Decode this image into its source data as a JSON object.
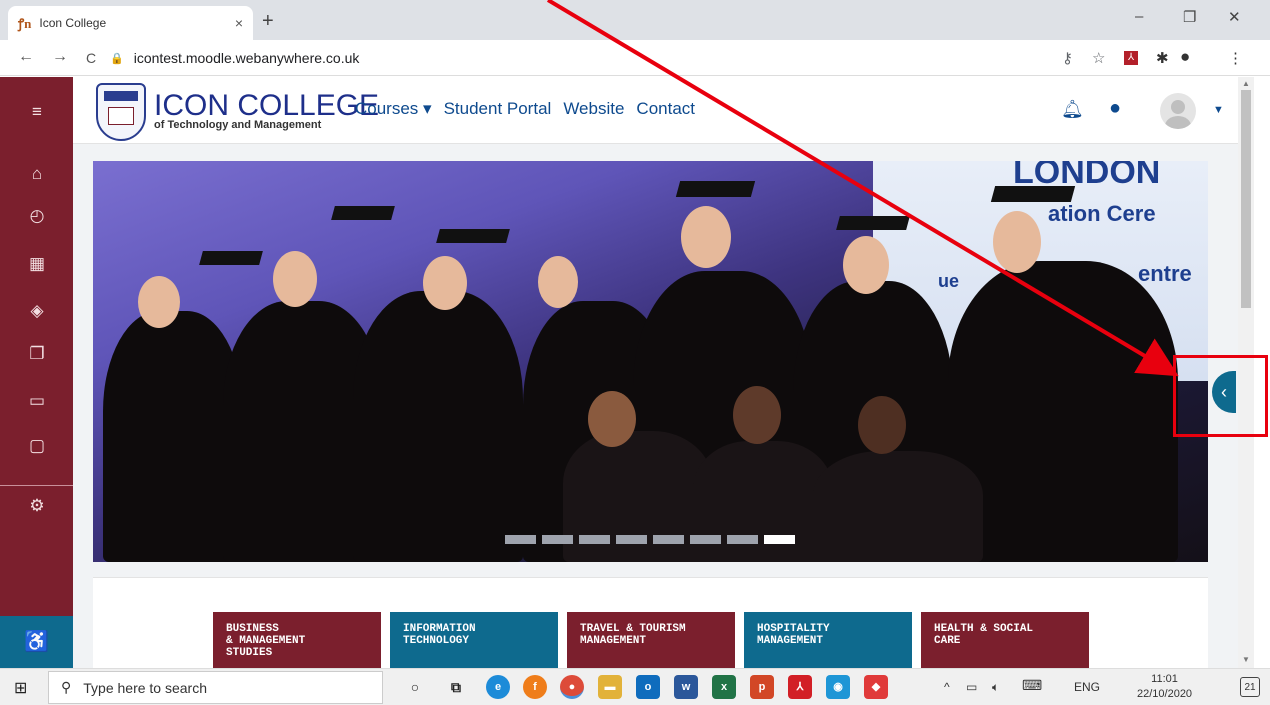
{
  "browser": {
    "tab_title": "Icon College",
    "tab_favicon": "ꝭn",
    "close_tab": "×",
    "new_tab": "+",
    "url": "icontest.moodle.webanywhere.co.uk",
    "window_controls": {
      "minimize": "–",
      "restore": "❐",
      "close": "✕"
    },
    "nav": {
      "back": "←",
      "forward": "→",
      "reload": "C"
    }
  },
  "header": {
    "logo_title": "ICON COLLEGE",
    "logo_subtitle": "of Technology and Management",
    "nav_items": [
      {
        "label": "Courses ▾"
      },
      {
        "label": "Student Portal"
      },
      {
        "label": "Website"
      },
      {
        "label": "Contact"
      }
    ]
  },
  "hero": {
    "banner_text_1": "LONDON",
    "banner_text_2": "ation Cere",
    "banner_text_3": "ue",
    "banner_text_4": "entre",
    "slides_total": 8,
    "active_slide": 8
  },
  "drawer_toggle": "‹",
  "tiles": [
    {
      "label": "BUSINESS\n& MANAGEMENT\nSTUDIES",
      "color": "#7b1f2d"
    },
    {
      "label": "INFORMATION\nTECHNOLOGY",
      "color": "#0e6a8e"
    },
    {
      "label": "TRAVEL & TOURISM\nMANAGEMENT",
      "color": "#7b1f2d"
    },
    {
      "label": "HOSPITALITY\nMANAGEMENT",
      "color": "#0e6a8e"
    },
    {
      "label": "HEALTH & SOCIAL\nCARE",
      "color": "#7b1f2d"
    }
  ],
  "taskbar": {
    "search_placeholder": "Type here to search",
    "language": "ENG",
    "time": "11:01",
    "date": "22/10/2020",
    "notifications": "21"
  },
  "colors": {
    "maroon": "#7b1f2d",
    "teal": "#0e6a8e",
    "annotation": "#e8000e"
  }
}
